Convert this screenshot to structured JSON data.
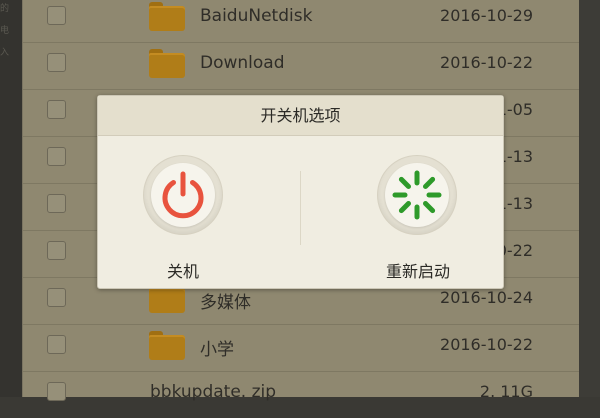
{
  "file_list": {
    "rows": [
      {
        "type": "folder",
        "name": "BaiduNetdisk",
        "date": "2016-10-29"
      },
      {
        "type": "folder",
        "name": "Download",
        "date": "2016-10-22"
      },
      {
        "type": "folder",
        "name": "",
        "date": "1-05"
      },
      {
        "type": "folder",
        "name": "",
        "date": "1-13"
      },
      {
        "type": "folder",
        "name": "",
        "date": "1-13"
      },
      {
        "type": "folder",
        "name": "",
        "date": "0-22"
      },
      {
        "type": "folder",
        "name": "多媒体",
        "date": "2016-10-24"
      },
      {
        "type": "folder",
        "name": "小学",
        "date": "2016-10-22"
      },
      {
        "type": "file",
        "name": "bbkupdate. zip",
        "date": "2. 11G"
      }
    ]
  },
  "left_strip": {
    "fragments": [
      "的",
      "电",
      "入"
    ]
  },
  "dialog": {
    "title": "开关机选项",
    "shutdown_label": "关机",
    "reboot_label": "重新启动"
  },
  "colors": {
    "power_icon": "#e8533e",
    "reboot_icon": "#2e9a2a",
    "overlay": "#8f8870"
  },
  "icons": {
    "shutdown": "power-icon",
    "reboot": "reboot-spinner-icon",
    "folder": "folder-icon"
  }
}
